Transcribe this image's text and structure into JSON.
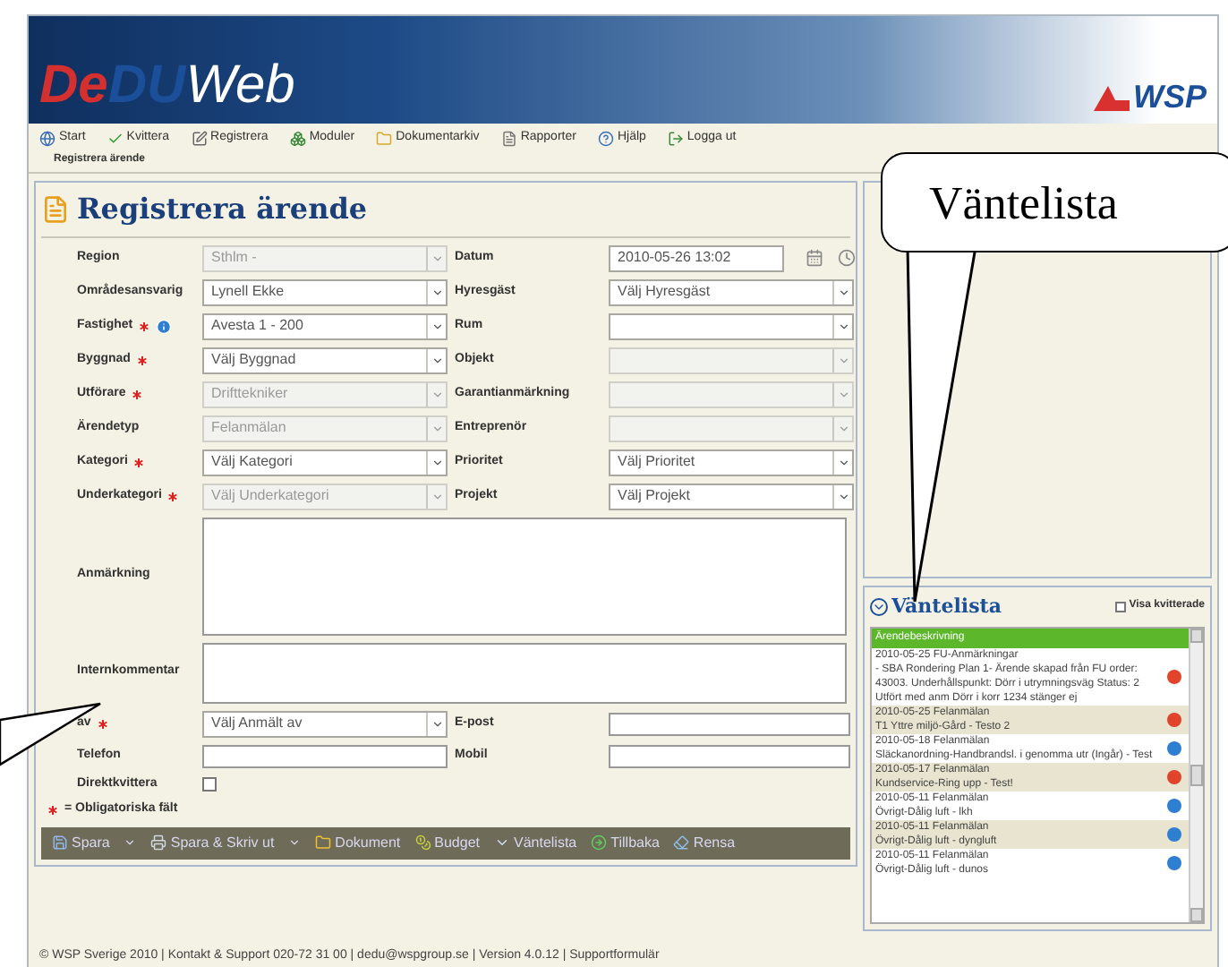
{
  "app": {
    "logo_parts": [
      "De",
      "DU",
      "Web"
    ],
    "brand": "WSP"
  },
  "menu": [
    {
      "label": "Start"
    },
    {
      "label": "Kvittera"
    },
    {
      "label": "Registrera"
    },
    {
      "label": "Moduler"
    },
    {
      "label": "Dokumentarkiv"
    },
    {
      "label": "Rapporter"
    },
    {
      "label": "Hjälp"
    },
    {
      "label": "Logga ut"
    }
  ],
  "breadcrumb": "Registrera ärende",
  "form": {
    "title": "Registrera ärende",
    "rows": [
      {
        "left": {
          "label": "Region",
          "required": false,
          "info": false,
          "value": "Sthlm -",
          "disabled": true
        },
        "right": {
          "label": "Datum",
          "kind": "date",
          "value": "2010-05-26 13:02"
        }
      },
      {
        "left": {
          "label": "Områdesansvarig",
          "required": false,
          "info": false,
          "value": "Lynell Ekke",
          "disabled": false
        },
        "right": {
          "label": "Hyresgäst",
          "kind": "select",
          "value": "Välj Hyresgäst",
          "disabled": false
        }
      },
      {
        "left": {
          "label": "Fastighet",
          "required": true,
          "info": true,
          "value": "Avesta 1 - 200",
          "disabled": false
        },
        "right": {
          "label": "Rum",
          "kind": "select",
          "disabled": false
        }
      },
      {
        "left": {
          "label": "Byggnad",
          "required": true,
          "info": false,
          "value": "Välj Byggnad",
          "disabled": false
        },
        "right": {
          "label": "Objekt",
          "kind": "select",
          "disabled": true
        }
      },
      {
        "left": {
          "label": "Utförare",
          "required": true,
          "info": false,
          "value": "Drifttekniker",
          "disabled": true
        },
        "right": {
          "label": "Garantianmärkning",
          "kind": "select",
          "disabled": true
        }
      },
      {
        "left": {
          "label": "Ärendetyp",
          "required": false,
          "info": false,
          "value": "Felanmälan",
          "disabled": true
        },
        "right": {
          "label": "Entreprenör",
          "kind": "select",
          "disabled": true
        }
      },
      {
        "left": {
          "label": "Kategori",
          "required": true,
          "info": false,
          "value": "Välj Kategori",
          "disabled": false
        },
        "right": {
          "label": "Prioritet",
          "kind": "select",
          "value": "Välj Prioritet",
          "disabled": false
        }
      },
      {
        "left": {
          "label": "Underkategori",
          "required": true,
          "info": false,
          "value": "Välj Underkategori",
          "disabled": true
        },
        "right": {
          "label": "Projekt",
          "kind": "select",
          "value": "Välj Projekt",
          "disabled": false
        }
      }
    ],
    "anmarkning": {
      "label": "Anmärkning"
    },
    "intern": {
      "label": "Internkommentar"
    },
    "contact": [
      {
        "left": {
          "label": "av",
          "required": true,
          "kind": "select",
          "value": "Välj Anmält av"
        },
        "right": {
          "label": "E-post"
        }
      },
      {
        "left": {
          "label": "Telefon",
          "required": false,
          "kind": "text"
        },
        "right": {
          "label": "Mobil"
        }
      }
    ],
    "direct": {
      "label": "Direktkvittera",
      "checked": false
    },
    "required_note": "= Obligatoriska fält",
    "actions": [
      {
        "label": "Spara",
        "dropdown": true
      },
      {
        "label": "Spara & Skriv ut",
        "dropdown": true
      },
      {
        "label": "Dokument",
        "dropdown": false
      },
      {
        "label": "Budget",
        "dropdown": false
      },
      {
        "label": "Väntelista",
        "dropdown": false
      },
      {
        "label": "Tillbaka",
        "dropdown": false
      },
      {
        "label": "Rensa",
        "dropdown": false
      }
    ]
  },
  "waitlist": {
    "title": "Väntelista",
    "show_acknowledged": {
      "label": "Visa kvitterade",
      "checked": false
    },
    "column": "Ärendebeskrivning",
    "items": [
      {
        "head": "2010-05-25 FU-Anmärkningar",
        "text": "- SBA Rondering Plan 1- Ärende skapad från FU order: 43003. Underhållspunkt: Dörr i utrymningsväg Status: 2 Utfört med anm Dörr i korr 1234 stänger ej",
        "color": "#e0452c"
      },
      {
        "head": "2010-05-25 Felanmälan",
        "text": "T1 Yttre miljö-Gård - Testo 2",
        "color": "#e0452c"
      },
      {
        "head": "2010-05-18 Felanmälan",
        "text": "Släckanordning-Handbrandsl. i genomma utr (Ingår) - Test",
        "color": "#2f7fd0"
      },
      {
        "head": "2010-05-17 Felanmälan",
        "text": "Kundservice-Ring upp - Test!",
        "color": "#e0452c"
      },
      {
        "head": "2010-05-11 Felanmälan",
        "text": "Övrigt-Dålig luft - lkh",
        "color": "#2f7fd0"
      },
      {
        "head": "2010-05-11 Felanmälan",
        "text": "Övrigt-Dålig luft - dyngluft",
        "color": "#2f7fd0"
      },
      {
        "head": "2010-05-11 Felanmälan",
        "text": "Övrigt-Dålig luft - dunos",
        "color": "#2f7fd0"
      }
    ]
  },
  "footer": "© WSP Sverige 2010 | Kontakt & Support 020-72 31 00 | dedu@wspgroup.se | Version 4.0.12 | Supportformulär",
  "callouts": [
    {
      "kind": "bubble",
      "text": "Väntelista"
    },
    {
      "kind": "pointer"
    }
  ]
}
